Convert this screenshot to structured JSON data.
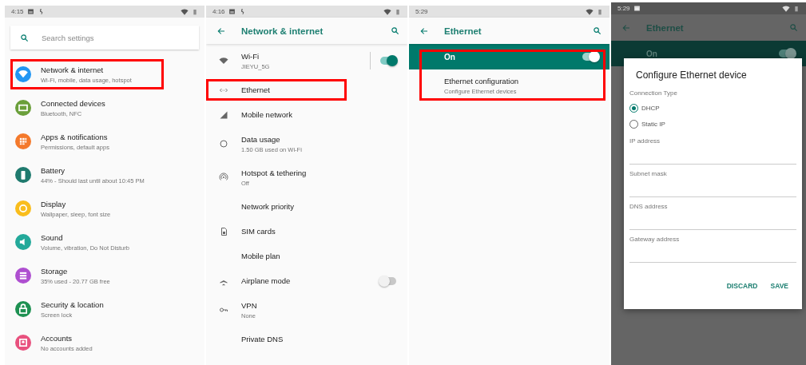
{
  "screens": [
    {
      "kind": "settings",
      "status": {
        "time": "4:15"
      },
      "search": {
        "placeholder": "Search settings"
      },
      "items": [
        {
          "title": "Network & internet",
          "subtitle": "Wi-Fi, mobile, data usage, hotspot",
          "color": "#2196f3",
          "highlighted": true
        },
        {
          "title": "Connected devices",
          "subtitle": "Bluetooth, NFC",
          "color": "#6a9f3a",
          "highlighted": false
        },
        {
          "title": "Apps & notifications",
          "subtitle": "Permissions, default apps",
          "color": "#f4792b",
          "highlighted": false
        },
        {
          "title": "Battery",
          "subtitle": "44% - Should last until about 10:45 PM",
          "color": "#1f7a6e",
          "highlighted": false
        },
        {
          "title": "Display",
          "subtitle": "Wallpaper, sleep, font size",
          "color": "#f9bd1c",
          "highlighted": false
        },
        {
          "title": "Sound",
          "subtitle": "Volume, vibration, Do Not Disturb",
          "color": "#23a99a",
          "highlighted": false
        },
        {
          "title": "Storage",
          "subtitle": "35% used - 20.77 GB free",
          "color": "#ae4fd0",
          "highlighted": false
        },
        {
          "title": "Security & location",
          "subtitle": "Screen lock",
          "color": "#1e9152",
          "highlighted": false
        },
        {
          "title": "Accounts",
          "subtitle": "No accounts added",
          "color": "#e8517e",
          "highlighted": false
        }
      ]
    },
    {
      "kind": "list",
      "status": {
        "time": "4:16"
      },
      "title": "Network & internet",
      "items": [
        {
          "kind": "switch",
          "title": "Wi-Fi",
          "subtitle": "JIEYU_5G",
          "on": true,
          "highlighted": false
        },
        {
          "kind": "plain",
          "title": "Ethernet",
          "highlighted": true
        },
        {
          "kind": "plain",
          "title": "Mobile network",
          "highlighted": false
        },
        {
          "kind": "plain",
          "title": "Data usage",
          "subtitle": "1.50 GB used on Wi-Fi",
          "highlighted": false
        },
        {
          "kind": "plain",
          "title": "Hotspot & tethering",
          "subtitle": "Off",
          "highlighted": false
        },
        {
          "kind": "plain",
          "title": "Network priority",
          "highlighted": false
        },
        {
          "kind": "plain",
          "title": "SIM cards",
          "highlighted": false
        },
        {
          "kind": "plain",
          "title": "Mobile plan",
          "highlighted": false
        },
        {
          "kind": "toggle",
          "title": "Airplane mode",
          "on": false,
          "highlighted": false
        },
        {
          "kind": "plain",
          "title": "VPN",
          "subtitle": "None",
          "highlighted": false
        },
        {
          "kind": "plain",
          "title": "Private DNS",
          "highlighted": false
        }
      ]
    },
    {
      "kind": "ethernet",
      "status": {
        "time": "5:29"
      },
      "title": "Ethernet",
      "highlighted": true,
      "master": {
        "label": "On",
        "on": true
      },
      "item": {
        "title": "Ethernet configuration",
        "subtitle": "Configure Ethernet devices"
      }
    },
    {
      "kind": "dialog",
      "status": {
        "time": "5:29"
      },
      "title": "Ethernet",
      "master": {
        "label": "On",
        "on": true
      },
      "dialog": {
        "title": "Configure Ethernet device",
        "section": "Connection Type",
        "options": [
          {
            "label": "DHCP",
            "selected": true
          },
          {
            "label": "Static IP",
            "selected": false
          }
        ],
        "fields": [
          {
            "placeholder": "IP address"
          },
          {
            "placeholder": "Subnet mask"
          },
          {
            "placeholder": "DNS address"
          },
          {
            "placeholder": "Gateway address"
          }
        ],
        "buttons": [
          "DISCARD",
          "SAVE"
        ]
      }
    }
  ]
}
